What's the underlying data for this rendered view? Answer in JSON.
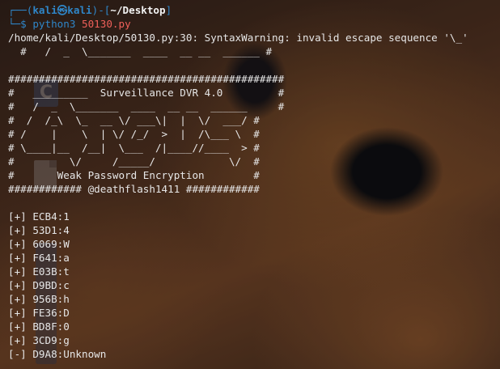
{
  "prompt": {
    "box_top": "┌──(",
    "user": "kali㉿kali",
    "box_mid": ")-[",
    "path": "~/Desktop",
    "box_end": "]",
    "box_bottom": "└─$ ",
    "command": "python3",
    "argument": "50130.py"
  },
  "warning_line": "/home/kali/Desktop/50130.py:30: SyntaxWarning: invalid escape sequence '\\_'",
  "warning_continuation": "  #   /  _  \\_______  ____  __ __  ______ #",
  "banner": [
    "",
    "#############################################",
    "#   _________  Surveillance DVR 4.0         #",
    "#   /  _  \\_______  ____  __ __  ______     #",
    "#  /  /_\\  \\_  __ \\/ ___\\|  |  \\/  ___/ #",
    "# /    |    \\  | \\/ /_/  >  |  /\\___ \\  #",
    "# \\____|__  /__|  \\___  /|____//____  > #",
    "#         \\/     /_____/            \\/  #",
    "#       Weak Password Encryption        #",
    "############ @deathflash1411 ############"
  ],
  "results": [
    "",
    "[+] ECB4:1",
    "[+] 53D1:4",
    "[+] 6069:W",
    "[+] F641:a",
    "[+] E03B:t",
    "[+] D9BD:c",
    "[+] 956B:h",
    "[+] FE36:D",
    "[+] BD8F:0",
    "[+] 3CD9:g",
    "[-] D9A8:Unknown"
  ],
  "colors": {
    "prompt_blue": "#2f86c8",
    "argument_red": "#f0605a",
    "text": "#e6e6e6"
  },
  "icons": [
    "file-icon",
    "c-source-icon"
  ]
}
